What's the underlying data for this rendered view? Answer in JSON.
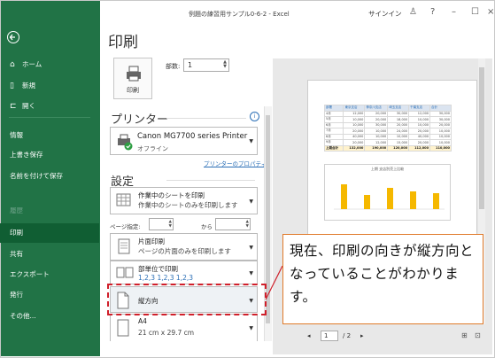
{
  "title_bar": {
    "document": "例題の練習用サンプル0-6-2 - Excel",
    "signin": "サインイン"
  },
  "sidebar": {
    "items": [
      {
        "label": "ホーム",
        "icon": "home-icon"
      },
      {
        "label": "新規",
        "icon": "new-document-icon"
      },
      {
        "label": "開く",
        "icon": "open-folder-icon"
      },
      {
        "label": "情報"
      },
      {
        "label": "上書き保存"
      },
      {
        "label": "名前を付けて保存"
      },
      {
        "label": "履歴"
      },
      {
        "label": "印刷"
      },
      {
        "label": "共有"
      },
      {
        "label": "エクスポート"
      },
      {
        "label": "発行"
      },
      {
        "label": "その他..."
      }
    ],
    "active": "印刷",
    "disabled": "履歴"
  },
  "page_title": "印刷",
  "print_button": "印刷",
  "copies": {
    "label": "部数:",
    "value": "1"
  },
  "printer": {
    "heading": "プリンター",
    "name": "Canon MG7700 series Printer",
    "status": "オフライン",
    "properties_link": "プリンターのプロパティ"
  },
  "settings": {
    "heading": "設定",
    "scope": {
      "line1": "作業中のシートを印刷",
      "line2": "作業中のシートのみを印刷します"
    },
    "pages": {
      "label": "ページ指定:",
      "to": "から"
    },
    "sides": {
      "line1": "片面印刷",
      "line2": "ページの片面のみを印刷します"
    },
    "collate": {
      "line1": "部単位で印刷",
      "line2": "1,2,3    1,2,3    1,2,3"
    },
    "orientation": "縦方向",
    "paper": {
      "line1": "A4",
      "line2": "21 cm x 29.7 cm"
    }
  },
  "preview": {
    "table_header": [
      "部署",
      "東京支店",
      "神奈川支店",
      "埼玉支店",
      "千葉支店",
      "合計"
    ],
    "table_rows": [
      [
        "4月",
        "12,000",
        "20,000",
        "30,000",
        "12,000",
        "30,000"
      ],
      [
        "5月",
        "10,000",
        "20,000",
        "18,000",
        "10,000",
        "30,000"
      ],
      [
        "6月",
        "10,000",
        "30,000",
        "20,000",
        "10,000",
        "20,000"
      ],
      [
        "7月",
        "20,000",
        "10,000",
        "24,000",
        "20,000",
        "10,000"
      ],
      [
        "8月",
        "40,000",
        "10,000",
        "10,000",
        "40,000",
        "10,000"
      ],
      [
        "9月",
        "20,000",
        "12,000",
        "15,000",
        "20,000",
        "10,000"
      ]
    ],
    "table_total": [
      "上期合計",
      "132,000",
      "190,000",
      "120,000",
      "112,000",
      "110,000"
    ],
    "chart_title": "上期 支店別売上比較",
    "page_current": "1",
    "page_total": "/ 2"
  },
  "callout": {
    "text": "現在、印刷の向きが縦方向となっていることがわかります。"
  },
  "colors": {
    "sidebar": "#217346",
    "callout_border": "#e07a2a",
    "highlight": "#d01f2a",
    "bar": "#f5b800"
  }
}
